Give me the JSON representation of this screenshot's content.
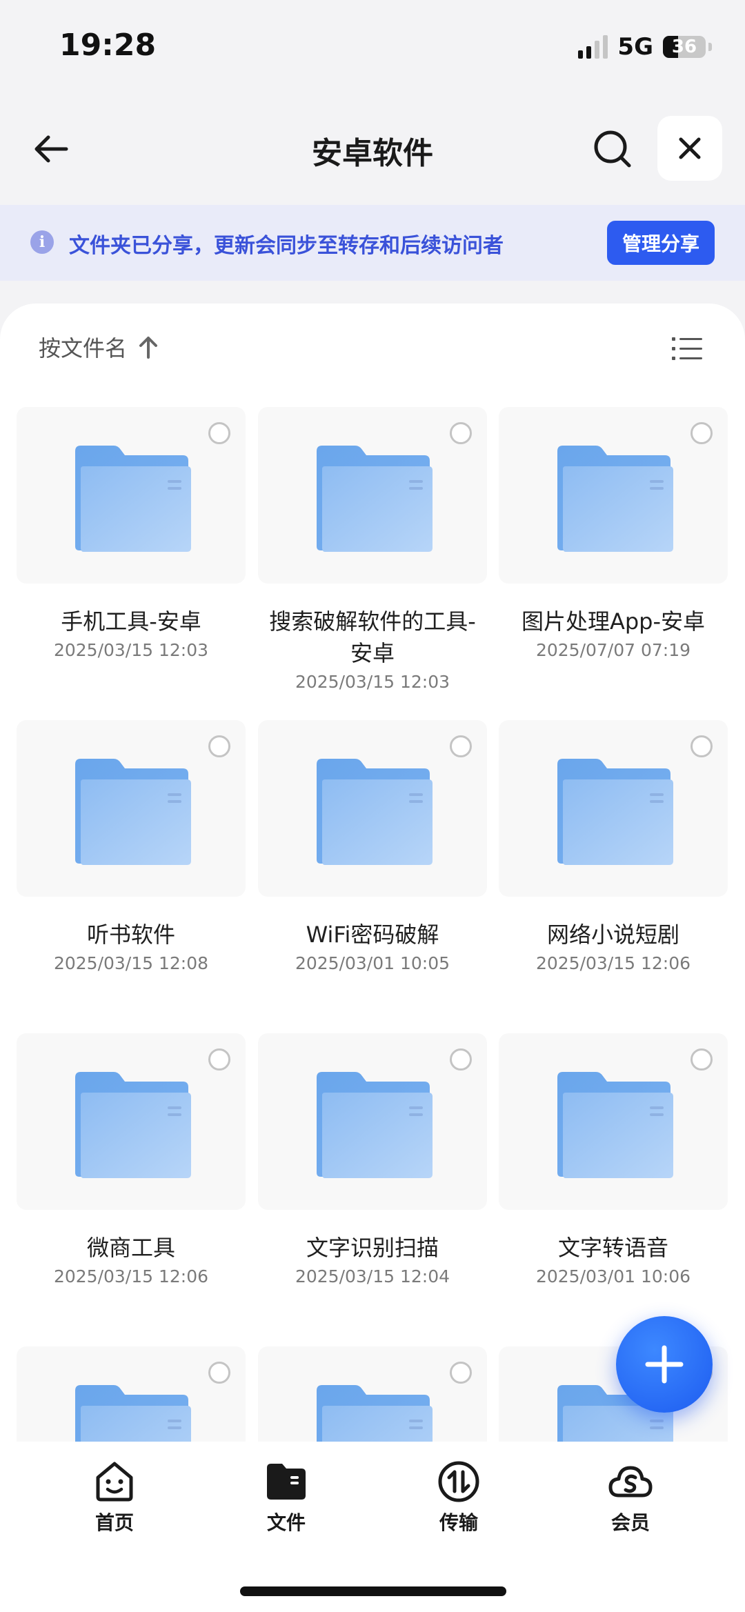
{
  "status_bar": {
    "time": "19:28",
    "network": "5G",
    "battery": "36",
    "battery_level_percent": 36
  },
  "nav": {
    "title": "安卓软件",
    "back_icon": "arrow-left-icon",
    "search_icon": "search-icon",
    "close_icon": "close-icon"
  },
  "banner": {
    "icon": "info-icon",
    "icon_glyph": "i",
    "text": "文件夹已分享，更新会同步至转存和后续访问者",
    "button": "管理分享"
  },
  "toolbar": {
    "sort_label": "按文件名",
    "sort_icon": "arrow-up-icon",
    "view_icon": "list-view-icon"
  },
  "files": [
    {
      "name": "手机工具-安卓",
      "date": "2025/03/15 12:03"
    },
    {
      "name": "搜索破解软件的工具-安卓",
      "date": "2025/03/15 12:03"
    },
    {
      "name": "图片处理App-安卓",
      "date": "2025/07/07 07:19"
    },
    {
      "name": "听书软件",
      "date": "2025/03/15 12:08"
    },
    {
      "name": "WiFi密码破解",
      "date": "2025/03/01 10:05"
    },
    {
      "name": "网络小说短剧",
      "date": "2025/03/15 12:06"
    },
    {
      "name": "微商工具",
      "date": "2025/03/15 12:06"
    },
    {
      "name": "文字识别扫描",
      "date": "2025/03/15 12:04"
    },
    {
      "name": "文字转语音",
      "date": "2025/03/01 10:06"
    }
  ],
  "fab": {
    "icon": "plus-icon"
  },
  "tabs": [
    {
      "label": "首页",
      "icon": "home-face-icon"
    },
    {
      "label": "文件",
      "icon": "folder-icon"
    },
    {
      "label": "传输",
      "icon": "transfer-icon"
    },
    {
      "label": "会员",
      "icon": "member-cloud-icon"
    }
  ],
  "colors": {
    "accent": "#2d5bf0",
    "banner_bg": "#e9ebf9",
    "banner_text": "#3a52d9",
    "folder": "#7fb3ee"
  }
}
